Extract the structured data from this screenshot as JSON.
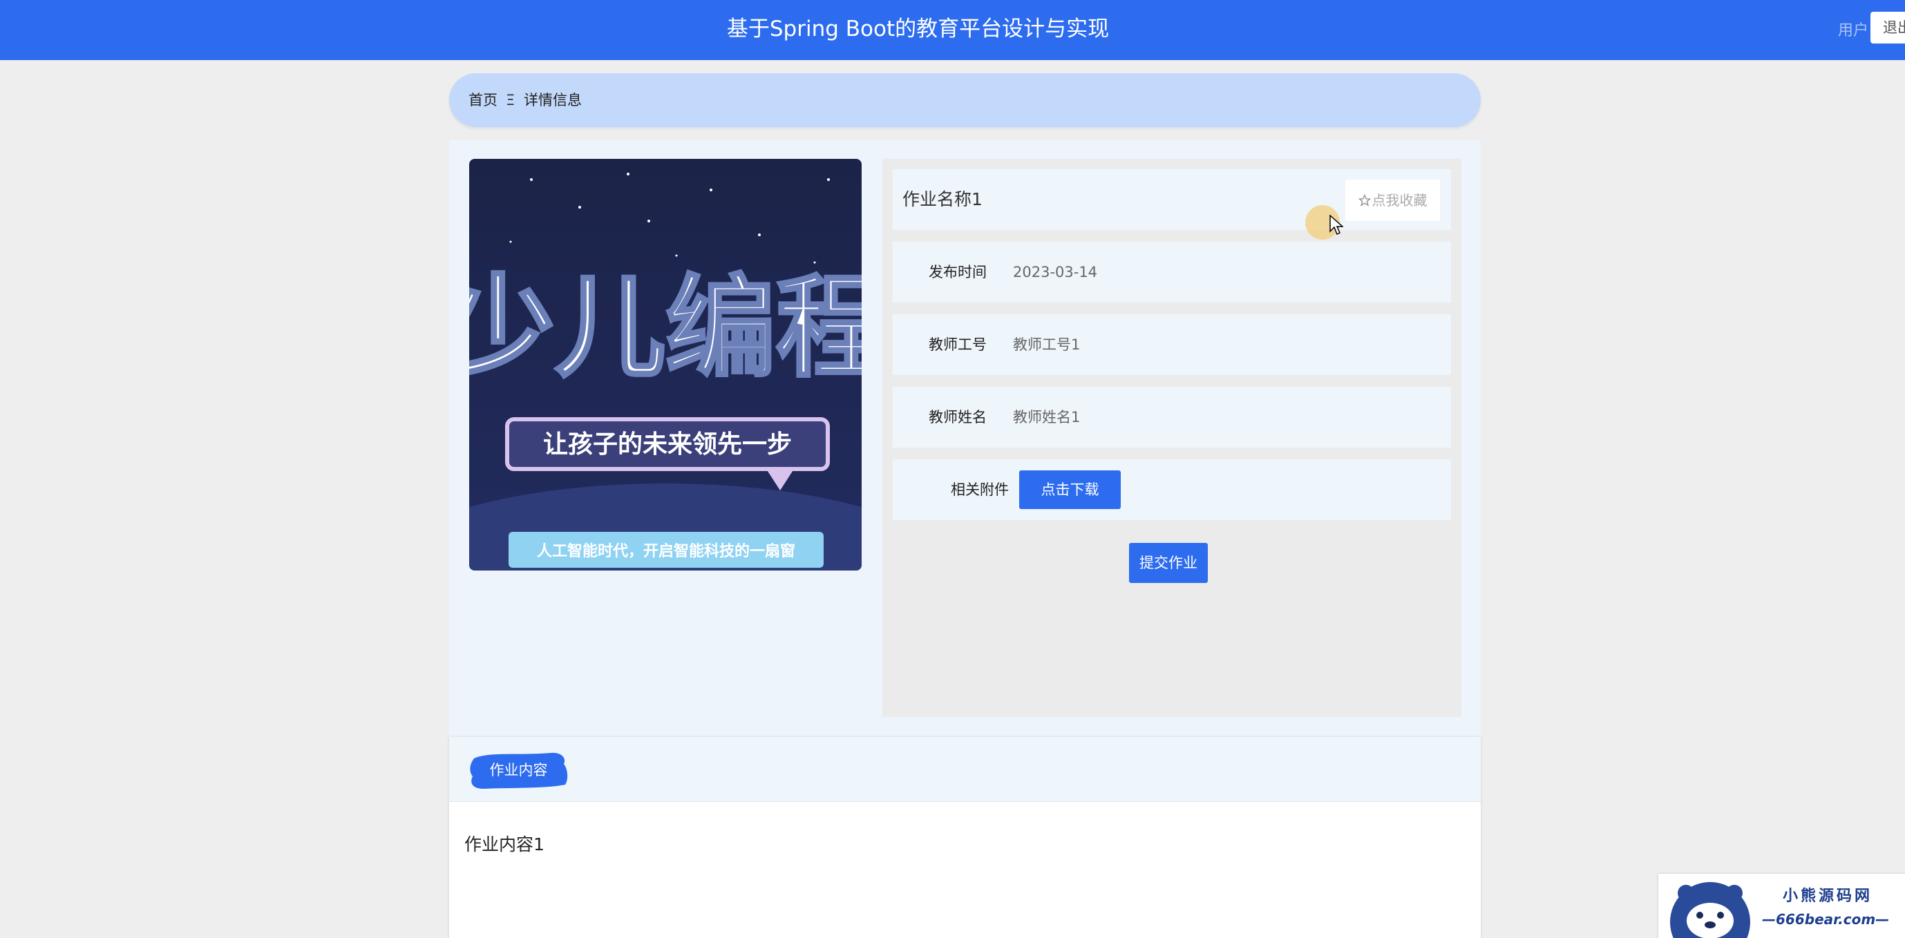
{
  "header": {
    "title": "基于Spring Boot的教育平台设计与实现",
    "right_text": "用户",
    "logout_label": "退出"
  },
  "breadcrumb": {
    "home": "首页",
    "separator": "Ξ",
    "current": "详情信息"
  },
  "detail": {
    "title": "作业名称1",
    "favorite_label": "点我收藏",
    "fields": [
      {
        "label": "发布时间",
        "value": "2023-03-14"
      },
      {
        "label": "教师工号",
        "value": "教师工号1"
      },
      {
        "label": "教师姓名",
        "value": "教师姓名1"
      },
      {
        "label": "相关附件",
        "button": "点击下载"
      }
    ],
    "submit_label": "提交作业"
  },
  "poster": {
    "headline": "少儿编程",
    "slogan": "让孩子的未来领先一步",
    "footer": "人工智能时代，开启智能科技的一扇窗"
  },
  "content": {
    "tab_label": "作业内容",
    "body": "作业内容1"
  },
  "watermark": {
    "line1": "小熊源码网",
    "line2": "—666bear.com—"
  },
  "colors": {
    "primary": "#2d6cef",
    "breadcrumb_bg": "#c3d9fb",
    "panel_bg": "#edf4fb"
  }
}
